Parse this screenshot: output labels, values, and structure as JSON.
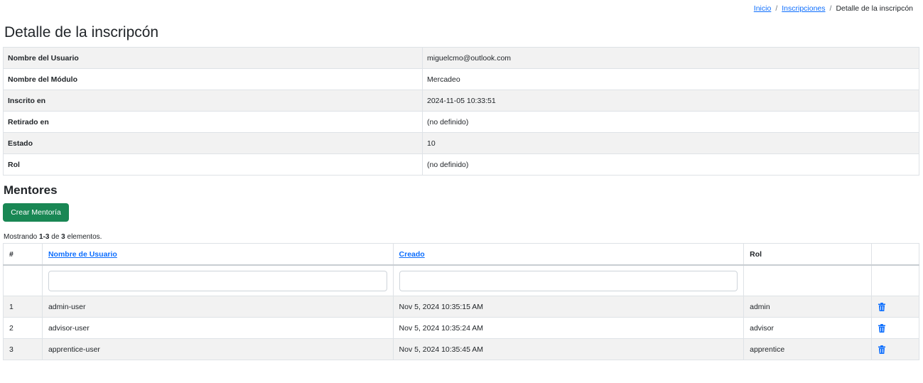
{
  "breadcrumb": {
    "home": "Inicio",
    "parent": "Inscripciones",
    "current": "Detalle de la inscripcón",
    "separator": "/"
  },
  "page_title": "Detalle de la inscripcón",
  "detail": [
    {
      "label": "Nombre del Usuario",
      "value": "miguelcmo@outlook.com"
    },
    {
      "label": "Nombre del Módulo",
      "value": "Mercadeo"
    },
    {
      "label": "Inscrito en",
      "value": "2024-11-05 10:33:51"
    },
    {
      "label": "Retirado en",
      "value": "(no definido)"
    },
    {
      "label": "Estado",
      "value": "10"
    },
    {
      "label": "Rol",
      "value": "(no definido)"
    }
  ],
  "mentors": {
    "title": "Mentores",
    "create_label": "Crear Mentoría",
    "summary": {
      "prefix": "Mostrando ",
      "range": "1-3",
      "middle": " de ",
      "total": "3",
      "suffix": " elementos."
    },
    "headers": {
      "num": "#",
      "username": "Nombre de Usuario",
      "created": "Creado",
      "role": "Rol"
    },
    "rows": [
      {
        "n": "1",
        "username": "admin-user",
        "created": "Nov 5, 2024 10:35:15 AM",
        "role": "admin"
      },
      {
        "n": "2",
        "username": "advisor-user",
        "created": "Nov 5, 2024 10:35:24 AM",
        "role": "advisor"
      },
      {
        "n": "3",
        "username": "apprentice-user",
        "created": "Nov 5, 2024 10:35:45 AM",
        "role": "apprentice"
      }
    ],
    "delete_icon": "trash-icon"
  },
  "colors": {
    "link": "#0d6efd",
    "button": "#198754",
    "stripe": "#f2f2f2"
  }
}
